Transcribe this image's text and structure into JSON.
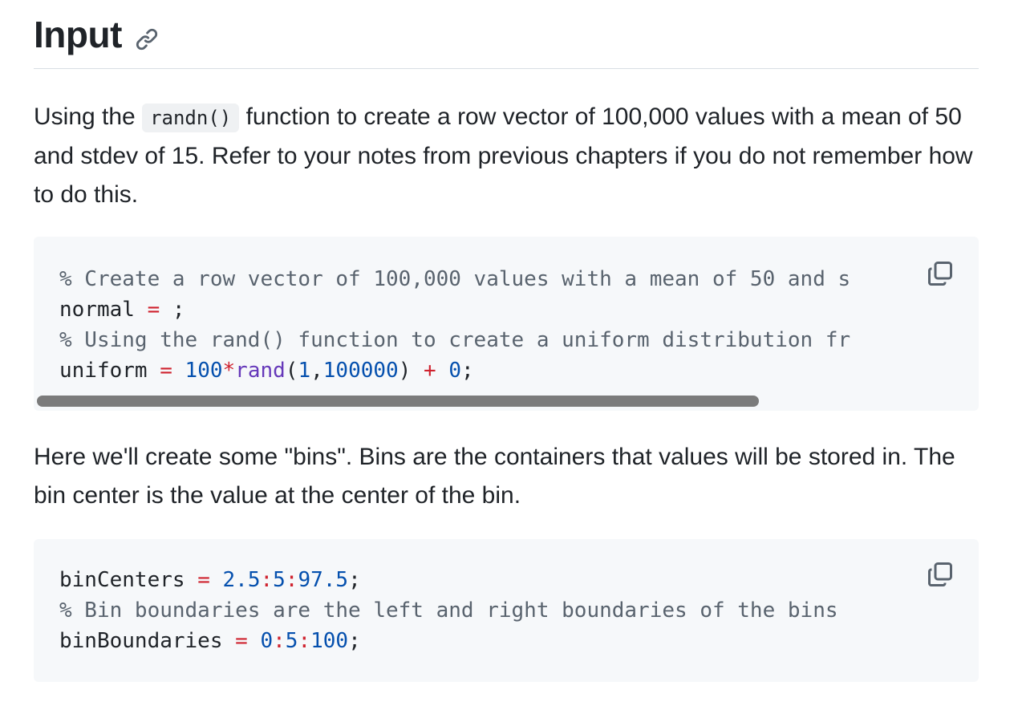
{
  "heading": {
    "title": "Input",
    "link_icon": "link-icon"
  },
  "paragraph1": {
    "before": "Using the ",
    "code": "randn()",
    "after": " function to create a row vector of 100,000 values with a mean of 50 and stdev of 15. Refer to your notes from previous chapters if you do not remember how to do this."
  },
  "code_block1": {
    "line1": "% Create a row vector of 100,000 values with a mean of 50 and s",
    "line2_var": "normal",
    "line2_eq": "=",
    "line2_end": ";",
    "line3": "% Using the rand() function to create a uniform distribution fr",
    "line4_var": "uniform",
    "line4_eq": "=",
    "line4_num1": "100",
    "line4_op1": "*",
    "line4_fn": "rand",
    "line4_paren_open": "(",
    "line4_arg1": "1",
    "line4_comma": ",",
    "line4_arg2": "100000",
    "line4_paren_close": ")",
    "line4_op2": "+",
    "line4_num2": "0",
    "line4_end": ";",
    "copy_icon": "copy-icon"
  },
  "paragraph2": {
    "text": "Here we'll create some \"bins\". Bins are the containers that values will be stored in. The bin center is the value at the center of the bin."
  },
  "code_block2": {
    "line1_var": "binCenters",
    "line1_eq": "=",
    "line1_a": "2.5",
    "line1_c1": ":",
    "line1_b": "5",
    "line1_c2": ":",
    "line1_c": "97.5",
    "line1_end": ";",
    "line2": "% Bin boundaries are the left and right boundaries of the bins",
    "line3_var": "binBoundaries",
    "line3_eq": "=",
    "line3_a": "0",
    "line3_c1": ":",
    "line3_b": "5",
    "line3_c2": ":",
    "line3_c": "100",
    "line3_end": ";",
    "copy_icon": "copy-icon"
  },
  "colors": {
    "comment": "#59636e",
    "operator": "#cf222e",
    "number": "#0550ae",
    "function": "#6639ba",
    "code_bg": "#f6f8fa"
  }
}
